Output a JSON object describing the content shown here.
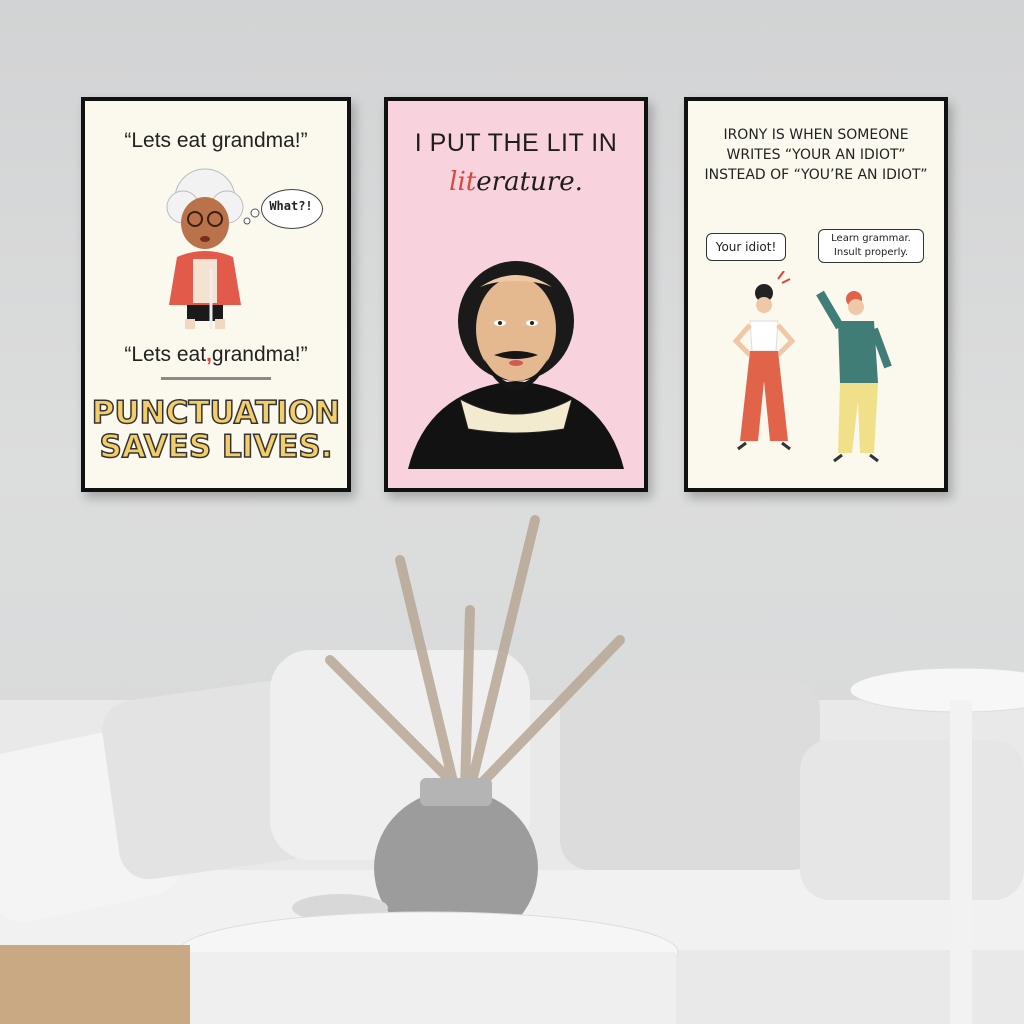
{
  "scene": {
    "wall_color": "#d7d8d9",
    "frame_color": "#111111"
  },
  "poster1": {
    "quote_top": "“Lets eat grandma!”",
    "thought": "What?!",
    "quote_bottom_pre": "“Lets eat",
    "quote_bottom_comma": ",",
    "quote_bottom_post": "grandma!”",
    "headline_line1": "PUNCTUATION",
    "headline_line2": "SAVES LIVES.",
    "bg": "#fbf8ee",
    "headline_color": "#f2cd6a",
    "comma_color": "#d8453a"
  },
  "poster2": {
    "line1": "I PUT THE LIT IN",
    "lit_part": "lit",
    "rest_part": "erature.",
    "bg": "#f8d2dc",
    "accent": "#d9473c"
  },
  "poster3": {
    "line1": "IRONY IS WHEN SOMEONE",
    "line2": "WRITES “YOUR AN IDIOT”",
    "line3": "INSTEAD OF “YOU’RE AN IDIOT”",
    "bubble_left": "Your idiot!",
    "bubble_right_1": "Learn grammar.",
    "bubble_right_2": "Insult properly.",
    "bg": "#fbf8ee"
  }
}
